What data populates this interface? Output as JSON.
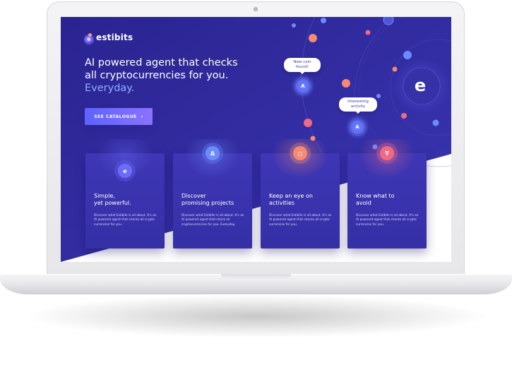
{
  "brand": {
    "name": "estibits",
    "mark": "e"
  },
  "hero": {
    "headline_line1": "AI powered agent that checks",
    "headline_line2": "all cryptocurrencies for you.",
    "headline_accent": "Everyday.",
    "cta_label": "SEE CATALOGUE",
    "cta_chevron": "›"
  },
  "network": {
    "bubble1": "New coin found!",
    "bubble2": "Interesting activity",
    "node_symbol": "A",
    "big_mark": "e"
  },
  "cards": [
    {
      "icon": "e",
      "title_line1": "Simple,",
      "title_line2": "yet powerful.",
      "body": "Discover what Estibits is all about. It's an AI powered agent that checks all crypto currencies for you."
    },
    {
      "icon": "Δ",
      "title_line1": "Discover",
      "title_line2": "promising projects",
      "body": "Discover what Estibits is all about. It's an AI powered agent that check all cryptocurrencies for you. Everyday."
    },
    {
      "icon": "○",
      "title_line1": "Keep an eye on",
      "title_line2": "activities",
      "body": "Discover what Estibits is all about. It's an AI powered agent that checks all crypto currencies for you."
    },
    {
      "icon": "∇",
      "title_line1": "Know what to",
      "title_line2": "avoid",
      "body": "Discover what Estibits is all about. It's an AI powered agent that checks all crypto currencies for you."
    }
  ],
  "colors": {
    "background_top": "#2b258f",
    "background_bottom": "#33309f",
    "accent": "#7b6dff",
    "coral": "#f48a73",
    "pink": "#f06a86",
    "blue": "#5b7bff"
  },
  "icons": [
    "estibits-logo-icon",
    "chevron-right-icon",
    "coin-node-icon",
    "circle-icon",
    "triangle-icon",
    "inverted-triangle-icon"
  ]
}
